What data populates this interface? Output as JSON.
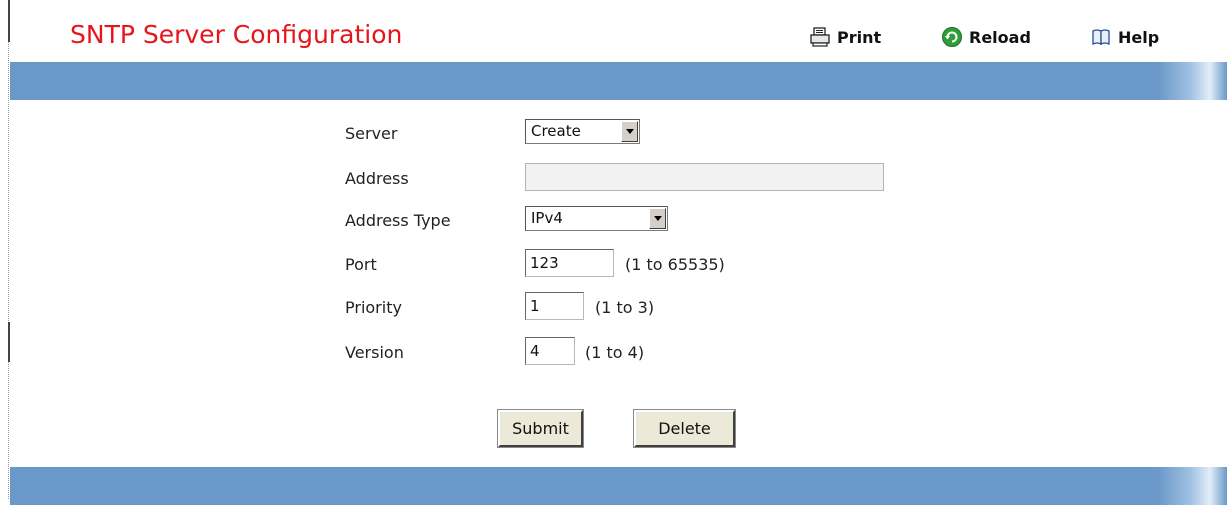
{
  "header": {
    "title": "SNTP Server Configuration",
    "toolbar": [
      {
        "label": "Print",
        "icon": "printer-icon"
      },
      {
        "label": "Reload",
        "icon": "reload-icon"
      },
      {
        "label": "Help",
        "icon": "help-book-icon"
      }
    ]
  },
  "form": {
    "server": {
      "label": "Server",
      "value": "Create"
    },
    "address": {
      "label": "Address",
      "value": ""
    },
    "address_type": {
      "label": "Address Type",
      "value": "IPv4"
    },
    "port": {
      "label": "Port",
      "value": "123",
      "range": "(1 to 65535)"
    },
    "priority": {
      "label": "Priority",
      "value": "1",
      "range": "(1 to 3)"
    },
    "version": {
      "label": "Version",
      "value": "4",
      "range": "(1 to 4)"
    }
  },
  "buttons": {
    "submit": "Submit",
    "delete": "Delete"
  },
  "colors": {
    "title": "#e8141c",
    "band": "#6a98c9",
    "reload_icon": "#2e9e3a"
  }
}
